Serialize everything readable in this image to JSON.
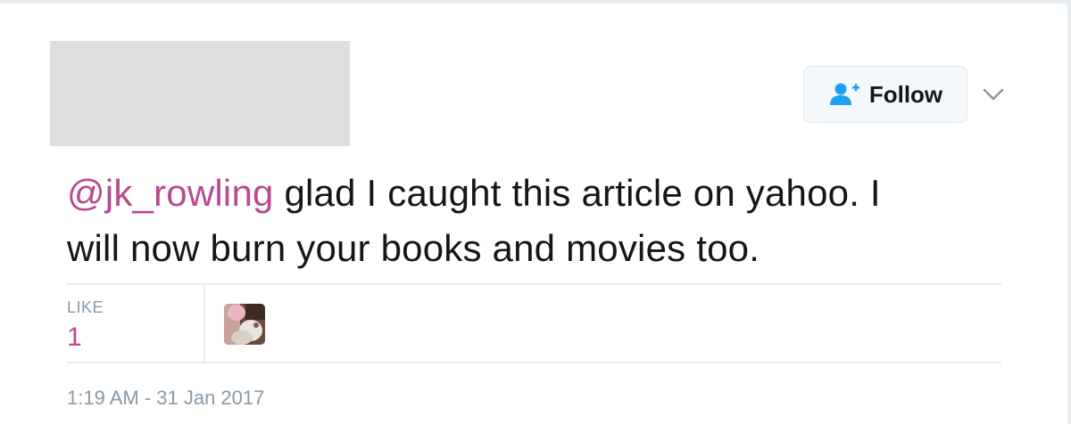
{
  "follow": {
    "label": "Follow",
    "icon": "add-user-icon",
    "icon_color": "#1da1f2"
  },
  "menu": {
    "icon": "chevron-down-icon"
  },
  "tweet": {
    "mention": "@jk_rowling",
    "text_line1": " glad I caught this article on yahoo. I",
    "text_line2": "will now burn your books and movies too.",
    "mention_color": "#b84a8f",
    "text_color": "#14171a"
  },
  "stats": {
    "like_label": "LIKE",
    "like_count": "1"
  },
  "meta": {
    "timestamp": "1:19 AM - 31 Jan 2017"
  }
}
